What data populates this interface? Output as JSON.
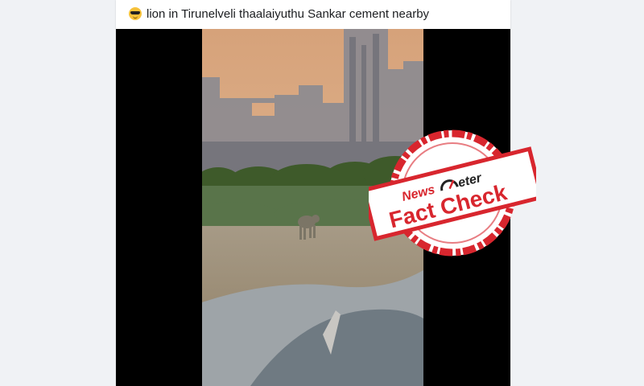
{
  "post": {
    "caption_emoji": "sunglasses-emoji",
    "caption_text": "lion in Tirunelveli thaalaiyuthu Sankar cement nearby"
  },
  "stamp": {
    "brand_left": "News",
    "brand_right": "eter",
    "title": "Fact Check",
    "color": "#d8262e"
  }
}
